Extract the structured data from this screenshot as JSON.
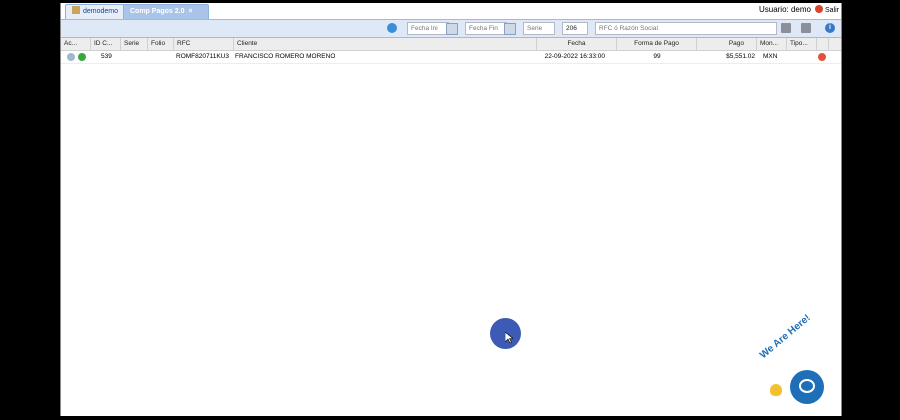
{
  "tabs": {
    "home": "demodemo",
    "active": "Comp Pagos 2.0",
    "active_close": "×"
  },
  "user": {
    "label": "Usuario: demo",
    "logout": "Salir"
  },
  "toolbar": {
    "fecha_ini_placeholder": "Fecha Ini",
    "fecha_fin_placeholder": "Fecha Fin",
    "serie_placeholder": "Serie",
    "page_value": "206",
    "rfc_placeholder": "RFC ó Razón Social"
  },
  "columns": {
    "ac": "Ac...",
    "id": "ID C...",
    "serie": "Serie",
    "folio": "Folio",
    "rfc": "RFC",
    "cliente": "Cliente",
    "fecha": "Fecha",
    "forma_pago": "Forma de Pago",
    "pago": "Pago",
    "moneda": "Mon...",
    "tipo": "Tipo..."
  },
  "rows": [
    {
      "id": "539",
      "serie": "",
      "folio": "",
      "rfc": "ROMF820711KU3",
      "cliente": "FRANCISCO ROMERO MORENO",
      "fecha": "22-09-2022 16:33:00",
      "forma_pago": "99",
      "pago": "$5,551.02",
      "moneda": "MXN"
    }
  ],
  "chat_widget": {
    "text": "We Are Here!"
  },
  "colors": {
    "tab_active": "#a9c4e8",
    "toolbar": "#dfe8f6",
    "chat": "#1e6fb8",
    "cursor_dot": "#3d5ab5"
  }
}
